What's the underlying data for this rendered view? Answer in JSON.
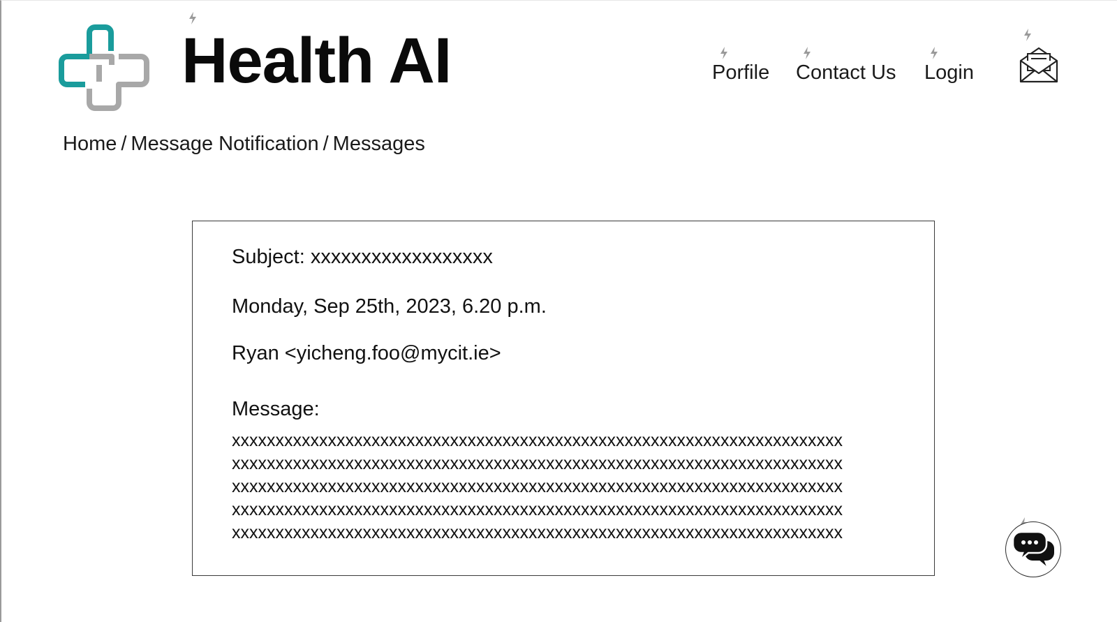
{
  "header": {
    "title": "Health AI",
    "logo_icon": "medical-cross-icon",
    "nav": {
      "profile": "Porfile",
      "contact": "Contact Us",
      "login": "Login"
    },
    "mail_icon": "envelope-icon"
  },
  "breadcrumb": {
    "home": "Home",
    "separator": "/",
    "notification": "Message Notification",
    "current": "Messages"
  },
  "message": {
    "subject": "Subject: xxxxxxxxxxxxxxxxxx",
    "date": "Monday, Sep 25th, 2023, 6.20 p.m.",
    "sender": "Ryan <yicheng.foo@mycit.ie>",
    "body_label": "Message:",
    "body_lines": [
      "xxxxxxxxxxxxxxxxxxxxxxxxxxxxxxxxxxxxxxxxxxxxxxxxxxxxxxxxxxxxxxxxxxxxxx",
      "xxxxxxxxxxxxxxxxxxxxxxxxxxxxxxxxxxxxxxxxxxxxxxxxxxxxxxxxxxxxxxxxxxxxxx",
      "xxxxxxxxxxxxxxxxxxxxxxxxxxxxxxxxxxxxxxxxxxxxxxxxxxxxxxxxxxxxxxxxxxxxxx",
      "xxxxxxxxxxxxxxxxxxxxxxxxxxxxxxxxxxxxxxxxxxxxxxxxxxxxxxxxxxxxxxxxxxxxxx",
      "xxxxxxxxxxxxxxxxxxxxxxxxxxxxxxxxxxxxxxxxxxxxxxxxxxxxxxxxxxxxxxxxxxxxxx"
    ]
  },
  "chat": {
    "icon": "chat-bubbles-icon"
  },
  "annotation_icon": "lightning-bolt-icon",
  "colors": {
    "logo_teal": "#1a9c9c",
    "logo_gray": "#a8a8a8",
    "text": "#111111",
    "card_border": "#3a3a3a",
    "bolt_gray": "#9a9a9a"
  }
}
